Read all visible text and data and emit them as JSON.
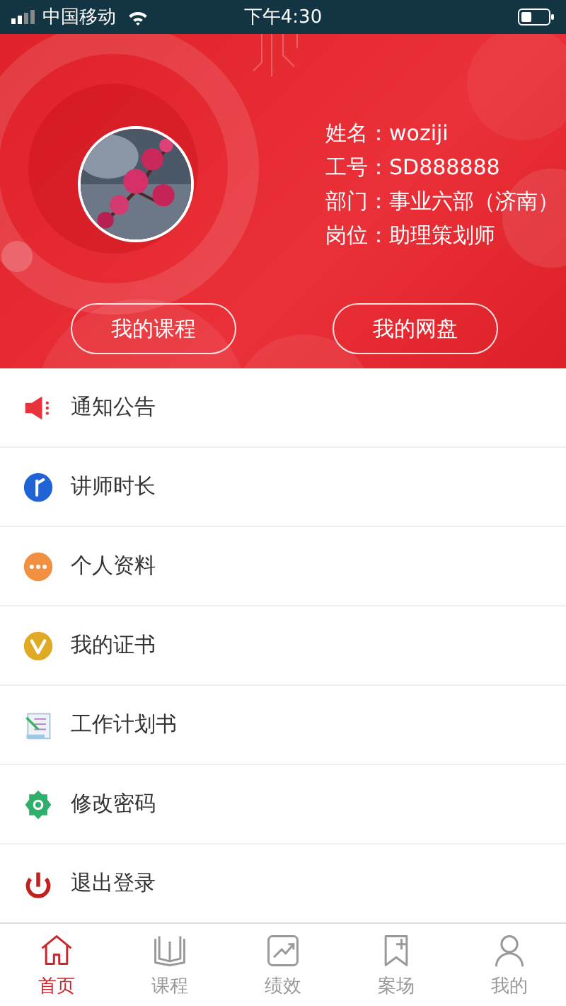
{
  "status_bar": {
    "carrier": "中国移动",
    "time": "下午4:30"
  },
  "profile": {
    "fields": [
      {
        "label": "姓名：",
        "value": "woziji"
      },
      {
        "label": "工号：",
        "value": "SD888888"
      },
      {
        "label": "部门：",
        "value": "事业六部（济南）"
      },
      {
        "label": "岗位：",
        "value": "助理策划师"
      }
    ],
    "buttons": [
      "我的课程",
      "我的网盘"
    ]
  },
  "menu": [
    {
      "kind": "megaphone",
      "label": "通知公告"
    },
    {
      "kind": "teacher",
      "label": "讲师时长"
    },
    {
      "kind": "dots",
      "label": "个人资料"
    },
    {
      "kind": "certificate",
      "label": "我的证书"
    },
    {
      "kind": "plan",
      "label": "工作计划书"
    },
    {
      "kind": "gear",
      "label": "修改密码"
    },
    {
      "kind": "power",
      "label": "退出登录"
    }
  ],
  "tab_bar": [
    {
      "kind": "home",
      "label": "首页",
      "selected": true
    },
    {
      "kind": "book",
      "label": "课程",
      "selected": false
    },
    {
      "kind": "chart",
      "label": "绩效",
      "selected": false
    },
    {
      "kind": "bookmark",
      "label": "案场",
      "selected": false
    },
    {
      "kind": "person",
      "label": "我的",
      "selected": false
    }
  ]
}
